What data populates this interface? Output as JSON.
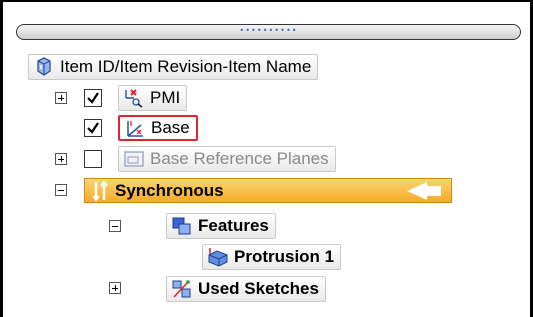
{
  "grip": {
    "dots": "••••••••••"
  },
  "tree": {
    "root": {
      "label": "Item ID/Item Revision-Item Name",
      "icon": "part-icon"
    },
    "pmi": {
      "label": "PMI",
      "checked": true,
      "expander": "plus",
      "icon": "pmi-icon"
    },
    "base": {
      "label": "Base",
      "checked": true,
      "selected": true,
      "icon": "coordinate-system-icon"
    },
    "base_reference_planes": {
      "label": "Base Reference Planes",
      "checked": false,
      "expander": "plus",
      "icon": "reference-plane-icon"
    },
    "synchronous": {
      "label": "Synchronous",
      "expander": "minus",
      "icon": "synchronous-icon",
      "highlight_color": "#f7b53a"
    },
    "features": {
      "label": "Features",
      "expander": "minus",
      "icon": "features-icon"
    },
    "protrusion": {
      "label": "Protrusion 1",
      "icon": "protrusion-icon"
    },
    "used_sketches": {
      "label": "Used Sketches",
      "expander": "plus",
      "icon": "sketch-icon"
    }
  },
  "colors": {
    "selection_border": "#e0242c",
    "sync_bar": "#f7b53a"
  }
}
